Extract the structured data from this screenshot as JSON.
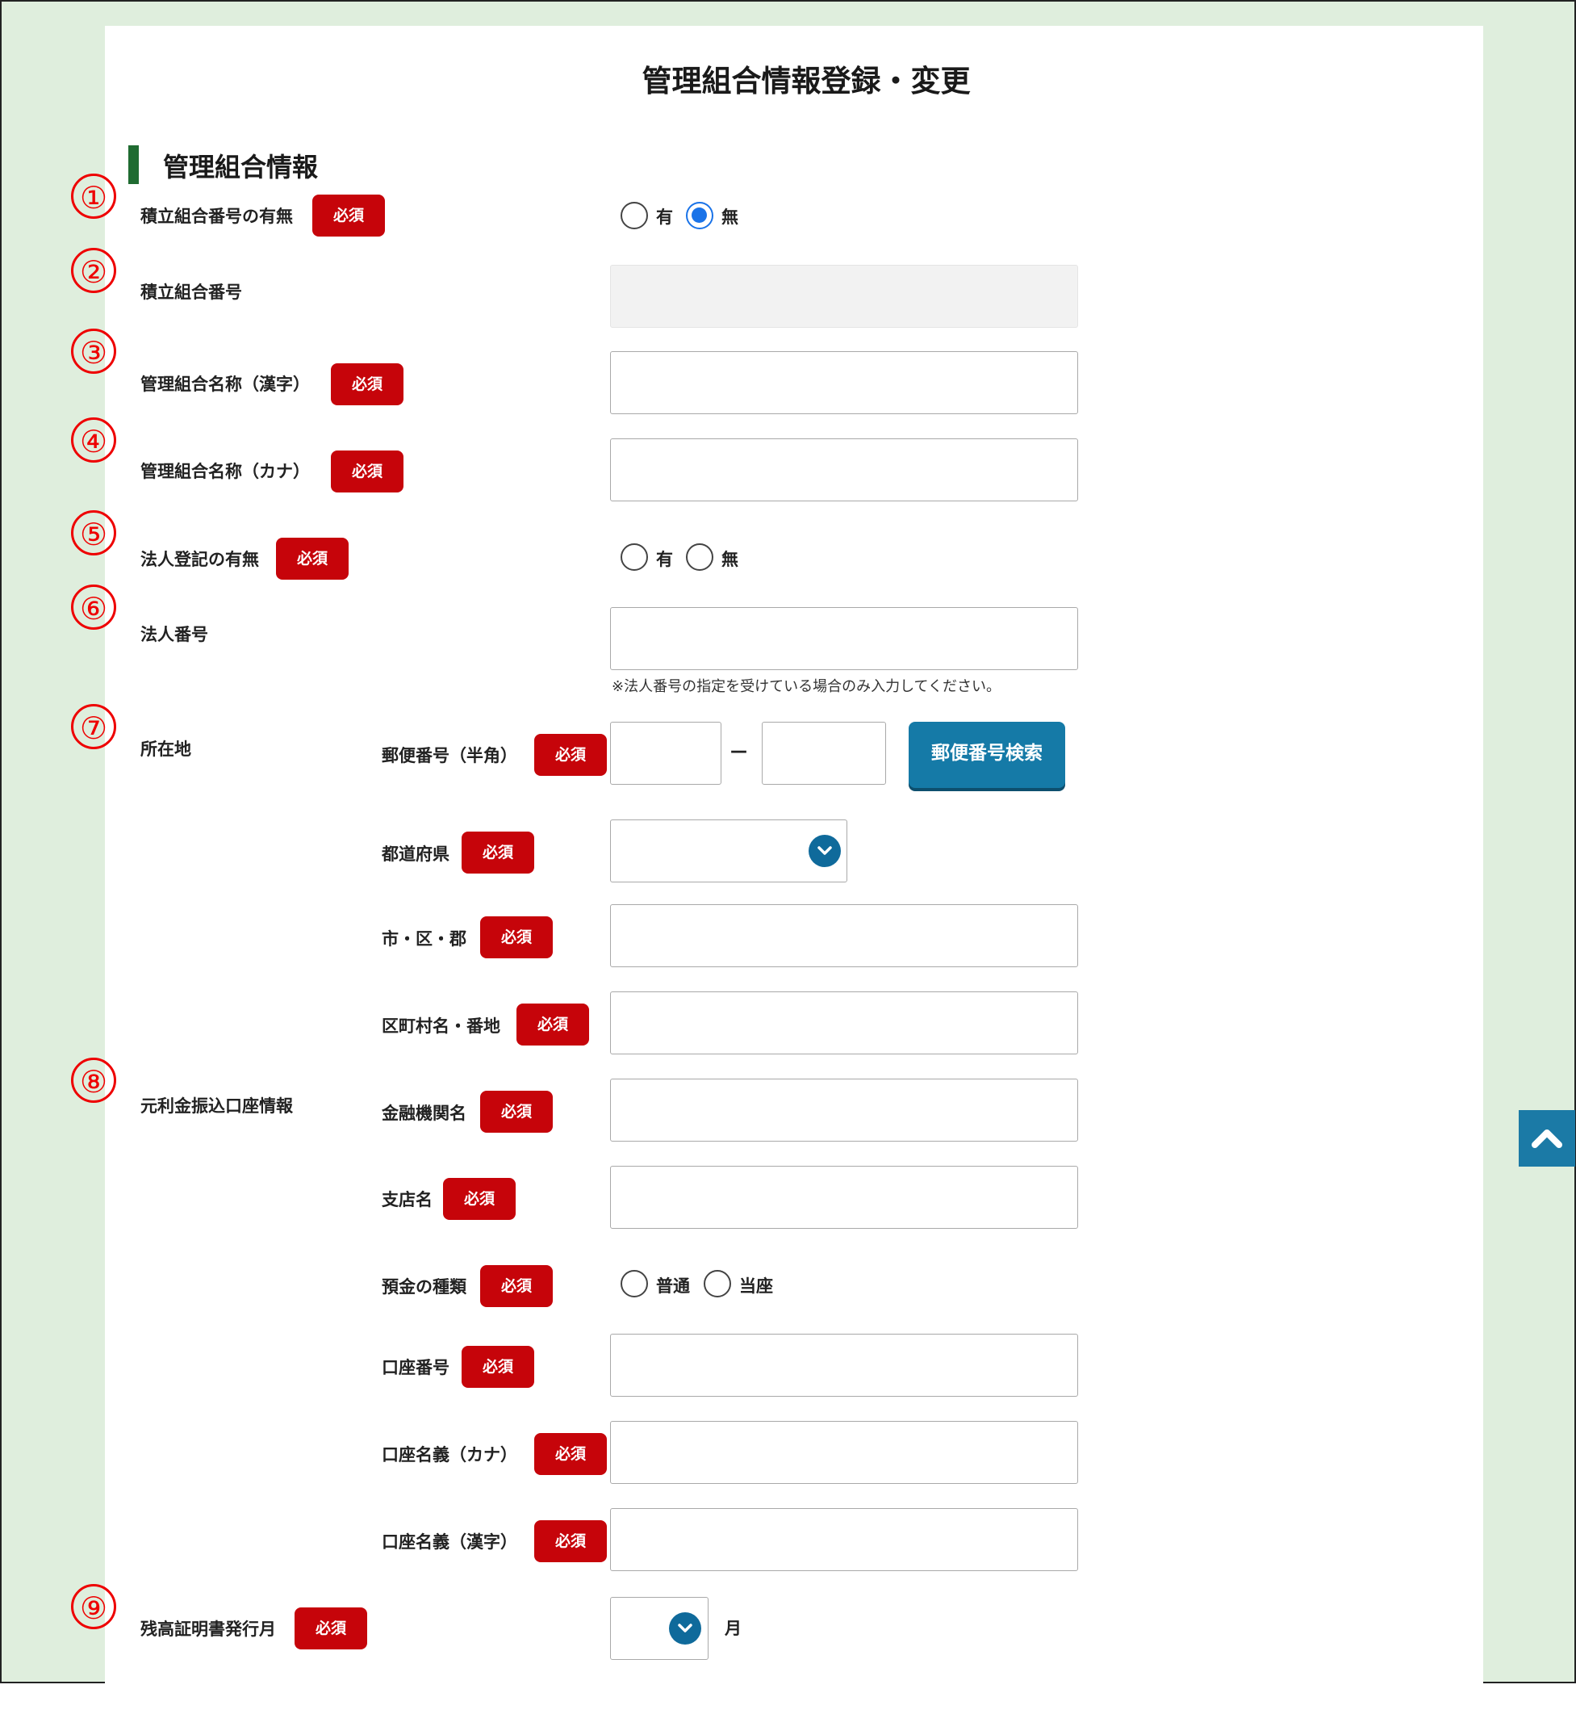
{
  "page": {
    "title": "管理組合情報登録・変更"
  },
  "section": {
    "title": "管理組合情報"
  },
  "required_badge": "必須",
  "markers": [
    "①",
    "②",
    "③",
    "④",
    "⑤",
    "⑥",
    "⑦",
    "⑧",
    "⑨"
  ],
  "fields": {
    "f1": {
      "label": "積立組合番号の有無",
      "options": [
        {
          "label": "有",
          "checked": false
        },
        {
          "label": "無",
          "checked": true
        }
      ]
    },
    "f2": {
      "label": "積立組合番号",
      "value": ""
    },
    "f3": {
      "label": "管理組合名称（漢字）",
      "value": ""
    },
    "f4": {
      "label": "管理組合名称（カナ）",
      "value": ""
    },
    "f5": {
      "label": "法人登記の有無",
      "options": [
        {
          "label": "有",
          "checked": false
        },
        {
          "label": "無",
          "checked": false
        }
      ]
    },
    "f6": {
      "label": "法人番号",
      "value": "",
      "note": "※法人番号の指定を受けている場合のみ入力してください。"
    },
    "f7": {
      "label": "所在地",
      "postal": {
        "label": "郵便番号（半角）",
        "part1": "",
        "separator": "—",
        "part2": "",
        "search_button": "郵便番号検索"
      },
      "prefecture": {
        "label": "都道府県",
        "selected": ""
      },
      "city": {
        "label": "市・区・郡",
        "value": ""
      },
      "street": {
        "label": "区町村名・番地",
        "value": ""
      }
    },
    "f8": {
      "label": "元利金振込口座情報",
      "bank": {
        "label": "金融機関名",
        "value": ""
      },
      "branch": {
        "label": "支店名",
        "value": ""
      },
      "deposit_type": {
        "label": "預金の種類",
        "options": [
          {
            "label": "普通",
            "checked": false
          },
          {
            "label": "当座",
            "checked": false
          }
        ]
      },
      "account_no": {
        "label": "口座番号",
        "value": ""
      },
      "holder_kana": {
        "label": "口座名義（カナ）",
        "value": ""
      },
      "holder_kanji": {
        "label": "口座名義（漢字）",
        "value": ""
      }
    },
    "f9": {
      "label": "残高証明書発行月",
      "selected": "",
      "unit": "月"
    }
  },
  "colors": {
    "accent_green": "#1f6b31",
    "required_red": "#c6040a",
    "button_blue": "#157aa7",
    "radio_blue": "#1a73e8",
    "frame_bg": "#dfeedd"
  },
  "icons": {
    "select_arrow": "chevron-down-icon",
    "scroll_top": "chevron-up-icon"
  }
}
